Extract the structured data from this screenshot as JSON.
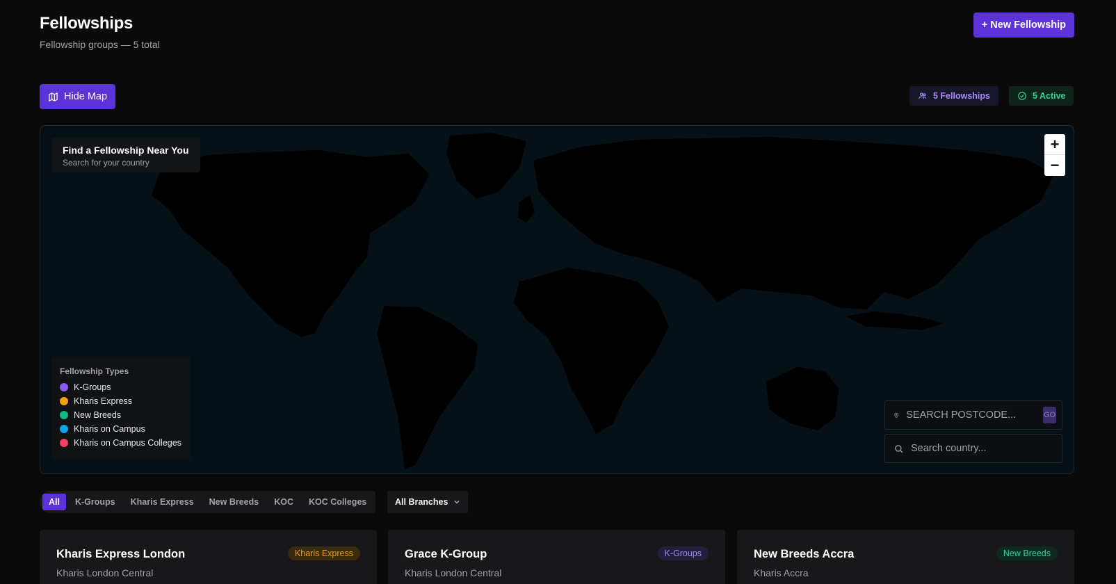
{
  "header": {
    "title": "Fellowships",
    "subtitle": "Fellowship groups — 5 total",
    "new_button": "+ New Fellowship"
  },
  "toolbar": {
    "hide_map_label": "Hide Map"
  },
  "stats": {
    "fellowships": "5 Fellowships",
    "active": "5 Active"
  },
  "map": {
    "finder_title": "Find a Fellowship Near You",
    "finder_subtitle": "Search for your country",
    "zoom_in": "+",
    "zoom_out": "−",
    "legend_title": "Fellowship Types",
    "legend": [
      {
        "label": "K-Groups",
        "color": "#8b5cf6"
      },
      {
        "label": "Kharis Express",
        "color": "#f59e0b"
      },
      {
        "label": "New Breeds",
        "color": "#10b981"
      },
      {
        "label": "Kharis on Campus",
        "color": "#0ea5e9"
      },
      {
        "label": "Kharis on Campus Colleges",
        "color": "#f43f5e"
      }
    ],
    "postcode_placeholder": "SEARCH POSTCODE...",
    "go_label": "GO",
    "country_placeholder": "Search country..."
  },
  "filters": {
    "tabs": [
      "All",
      "K-Groups",
      "Kharis Express",
      "New Breeds",
      "KOC",
      "KOC Colleges"
    ],
    "active": "All",
    "branch": "All Branches"
  },
  "cards": [
    {
      "title": "Kharis Express London",
      "branch": "Kharis London Central",
      "badge": "Kharis Express",
      "badge_bg": "#3a2a0e",
      "badge_color": "#f59e0b"
    },
    {
      "title": "Grace K-Group",
      "branch": "Kharis London Central",
      "badge": "K-Groups",
      "badge_bg": "#241d3d",
      "badge_color": "#a78bfa"
    },
    {
      "title": "New Breeds Accra",
      "branch": "Kharis Accra",
      "badge": "New Breeds",
      "badge_bg": "#0d2a20",
      "badge_color": "#34d399"
    }
  ]
}
